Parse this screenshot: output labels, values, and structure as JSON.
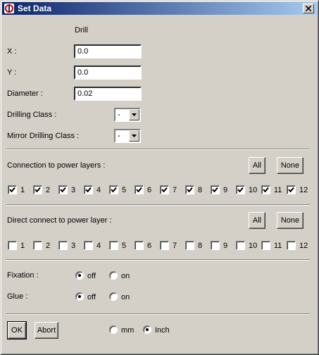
{
  "window": {
    "title": "Set Data",
    "close_glyph": "✕"
  },
  "header": {
    "section_label": "Drill"
  },
  "fields": {
    "x": {
      "label": "X :",
      "value": "0.0"
    },
    "y": {
      "label": "Y :",
      "value": "0.0"
    },
    "diameter": {
      "label": "Diameter :",
      "value": "0.02"
    }
  },
  "selects": {
    "drilling_class": {
      "label": "Drilling Class :",
      "value": "-"
    },
    "mirror_drilling_class": {
      "label": "Mirror Drilling Class :",
      "value": "-"
    }
  },
  "connection": {
    "label": "Connection to power layers :",
    "all_label": "All",
    "none_label": "None",
    "layers": [
      {
        "label": "1",
        "checked": true
      },
      {
        "label": "2",
        "checked": true
      },
      {
        "label": "3",
        "checked": true
      },
      {
        "label": "4",
        "checked": true
      },
      {
        "label": "5",
        "checked": true
      },
      {
        "label": "6",
        "checked": true
      },
      {
        "label": "7",
        "checked": true
      },
      {
        "label": "8",
        "checked": true
      },
      {
        "label": "9",
        "checked": true
      },
      {
        "label": "10",
        "checked": true
      },
      {
        "label": "11",
        "checked": true
      },
      {
        "label": "12",
        "checked": true
      }
    ]
  },
  "direct": {
    "label": "Direct connect to power layer :",
    "all_label": "All",
    "none_label": "None",
    "layers": [
      {
        "label": "1",
        "checked": false
      },
      {
        "label": "2",
        "checked": false
      },
      {
        "label": "3",
        "checked": false
      },
      {
        "label": "4",
        "checked": false
      },
      {
        "label": "5",
        "checked": false
      },
      {
        "label": "6",
        "checked": false
      },
      {
        "label": "7",
        "checked": false
      },
      {
        "label": "8",
        "checked": false
      },
      {
        "label": "9",
        "checked": false
      },
      {
        "label": "10",
        "checked": false
      },
      {
        "label": "11",
        "checked": false
      },
      {
        "label": "12",
        "checked": false
      }
    ]
  },
  "fixation": {
    "label": "Fixation :",
    "off": "off",
    "on": "on",
    "selected": "off"
  },
  "glue": {
    "label": "Glue :",
    "off": "off",
    "on": "on",
    "selected": "off"
  },
  "footer": {
    "ok_label": "OK",
    "abort_label": "Abort",
    "mm_label": "mm",
    "inch_label": "Inch",
    "unit_selected": "inch"
  }
}
